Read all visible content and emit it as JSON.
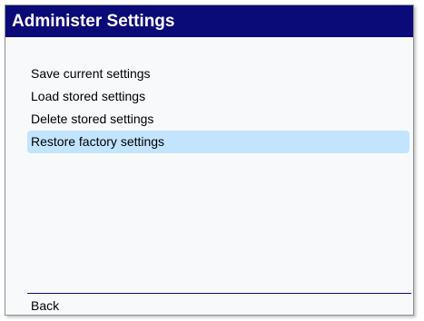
{
  "header": {
    "title": "Administer Settings"
  },
  "menu": {
    "items": [
      {
        "label": "Save current settings"
      },
      {
        "label": "Load stored settings"
      },
      {
        "label": "Delete stored settings"
      },
      {
        "label": "Restore factory settings"
      }
    ],
    "selected_index": 3
  },
  "footer": {
    "back_label": "Back"
  },
  "colors": {
    "title_bar": "#0a0a78",
    "selection": "#c2e4ff",
    "background": "#f7f9fb"
  }
}
